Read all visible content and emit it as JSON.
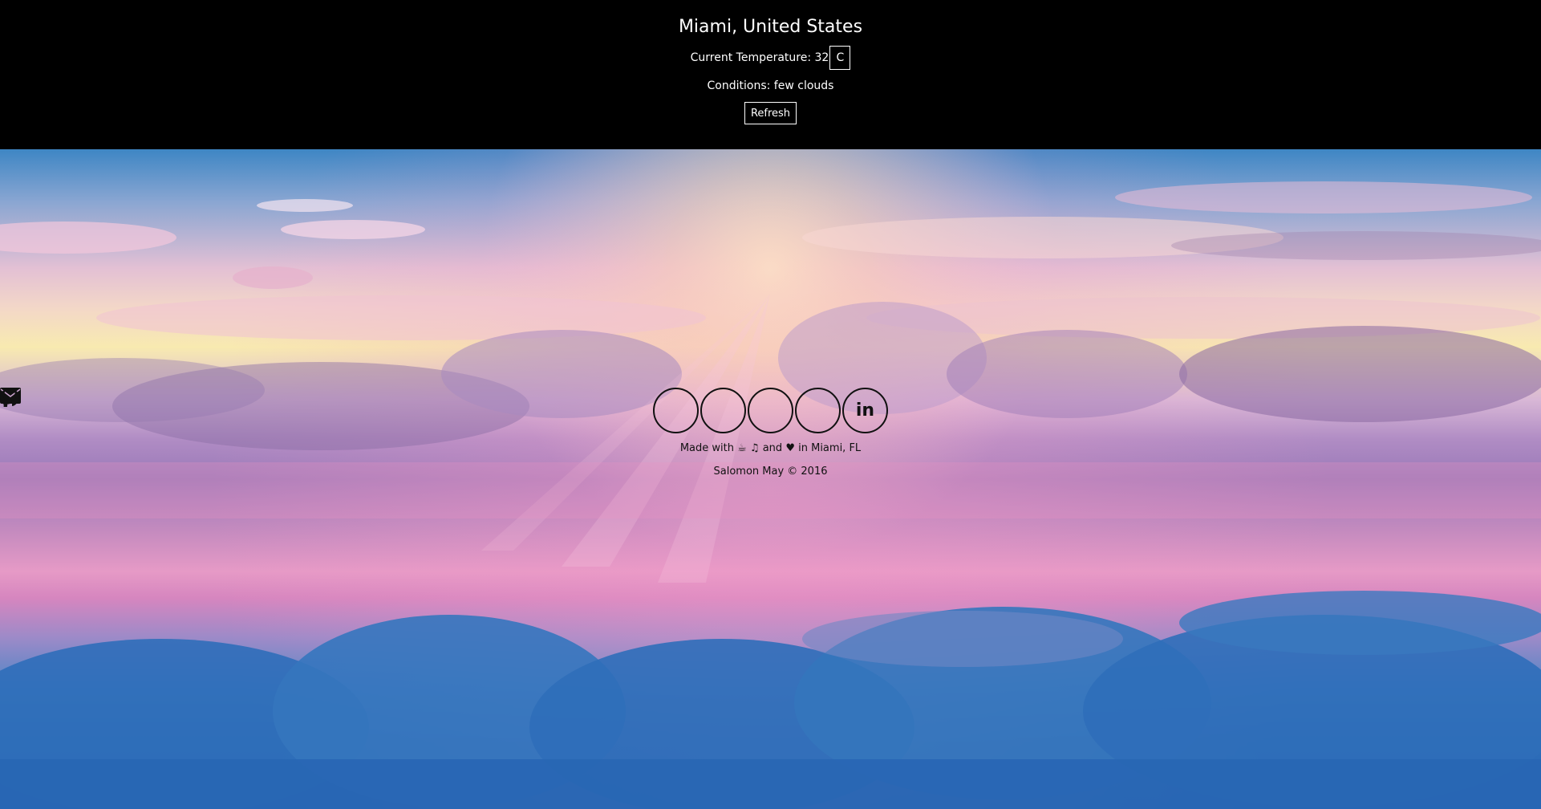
{
  "header": {
    "city": "Miami, United States",
    "temperature_label": "Current Temperature: 32",
    "unit": "C",
    "conditions": "Conditions: few clouds",
    "refresh_label": "Refresh"
  },
  "social": [
    {
      "name": "twitter-icon"
    },
    {
      "name": "facebook-icon"
    },
    {
      "name": "email-icon"
    },
    {
      "name": "github-icon"
    },
    {
      "name": "linkedin-icon",
      "label": "in"
    }
  ],
  "footer": {
    "made_with_prefix": "Made with",
    "coffee_glyph": "☕",
    "music_glyph": "♫",
    "and_text": "and",
    "heart_glyph": "♥",
    "location_text": "in Miami, FL",
    "copyright": "Salomon May © 2016"
  },
  "colors": {
    "header_bg": "#000000",
    "header_text": "#ffffff",
    "footer_text": "#111111"
  }
}
